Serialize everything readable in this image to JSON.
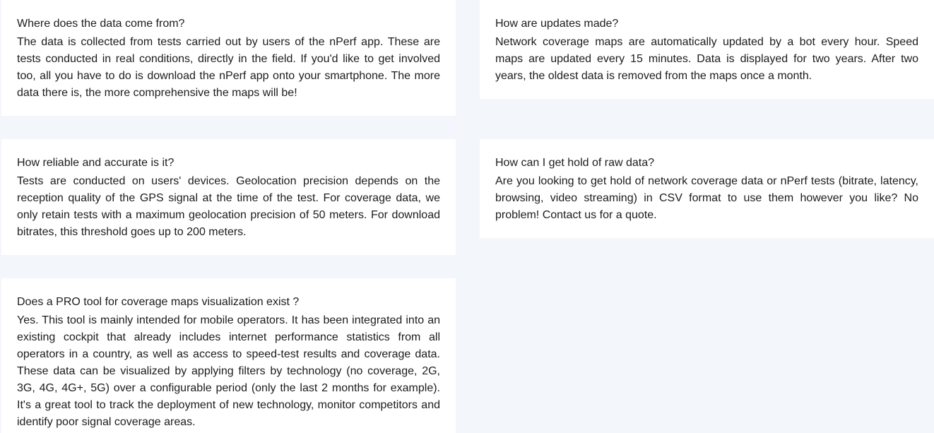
{
  "faq": {
    "items": [
      {
        "question": "Where does the data come from?",
        "answer": "The data is collected from tests carried out by users of the nPerf app. These are tests conducted in real conditions, directly in the field. If you'd like to get involved too, all you have to do is download the nPerf app onto your smartphone. The more data there is, the more comprehensive the maps will be!"
      },
      {
        "question": "How are updates made?",
        "answer": "Network coverage maps are automatically updated by a bot every hour. Speed maps are updated every 15 minutes. Data is displayed for two years. After two years, the oldest data is removed from the maps once a month."
      },
      {
        "question": "How reliable and accurate is it?",
        "answer": "Tests are conducted on users' devices. Geolocation precision depends on the reception quality of the GPS signal at the time of the test. For coverage data, we only retain tests with a maximum geolocation precision of 50 meters. For download bitrates, this threshold goes up to 200 meters."
      },
      {
        "question": "How can I get hold of raw data?",
        "answer": "Are you looking to get hold of network coverage data or nPerf tests (bitrate, latency, browsing, video streaming) in CSV format to use them however you like? No problem! Contact us for a quote."
      },
      {
        "question": "Does a PRO tool for coverage maps visualization exist ?",
        "answer": "Yes. This tool is mainly intended for mobile operators. It has been integrated into an existing cockpit that already includes internet performance statistics from all operators in a country, as well as access to speed-test results and coverage data. These data can be visualized by applying filters by technology (no coverage, 2G, 3G, 4G, 4G+, 5G) over a configurable period (only the last 2 months for example). It's a great tool to track the deployment of new technology, monitor competitors and identify poor signal coverage areas."
      }
    ]
  }
}
